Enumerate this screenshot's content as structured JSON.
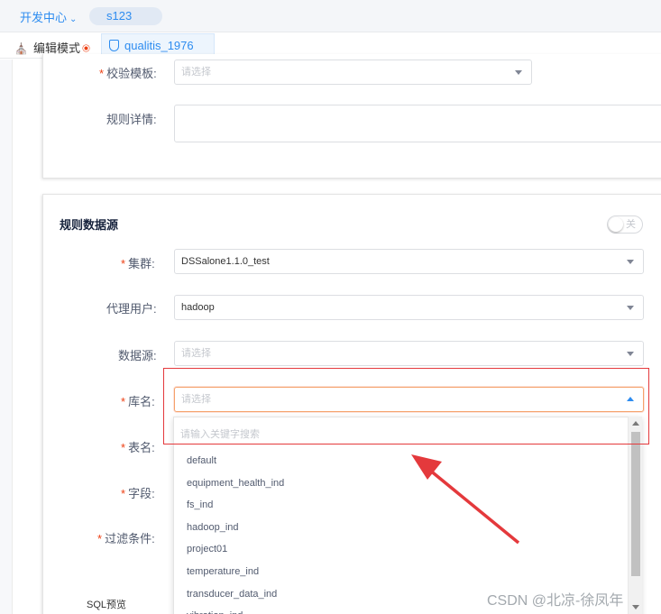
{
  "header": {
    "dev_center": "开发中心",
    "project": "s123"
  },
  "tabs": {
    "edit_mode": "编辑模式",
    "qualitis_tab": "qualitis_1976"
  },
  "rule_form": {
    "template_label": "校验模板:",
    "template_placeholder": "请选择",
    "detail_label": "规则详情:"
  },
  "data_source": {
    "title": "规则数据源",
    "toggle_text": "关",
    "cluster_label": "集群:",
    "cluster_value": "DSSalone1.1.0_test",
    "proxy_user_label": "代理用户:",
    "proxy_user_value": "hadoop",
    "datasource_label": "数据源:",
    "datasource_placeholder": "请选择",
    "db_label": "库名:",
    "db_placeholder": "请选择",
    "table_label": "表名:",
    "field_label": "字段:",
    "filter_label": "过滤条件:",
    "sql_preview_label": "SQL预览"
  },
  "db_dropdown": {
    "search_placeholder": "请输入关键字搜索",
    "items": [
      "default",
      "equipment_health_ind",
      "fs_ind",
      "hadoop_ind",
      "project01",
      "temperature_ind",
      "transducer_data_ind",
      "vibration_ind"
    ]
  },
  "watermark": "CSDN @北凉-徐凤年",
  "colors": {
    "accent": "#2d8cf0",
    "required": "#ed4014",
    "annotation": "#e4393c"
  }
}
